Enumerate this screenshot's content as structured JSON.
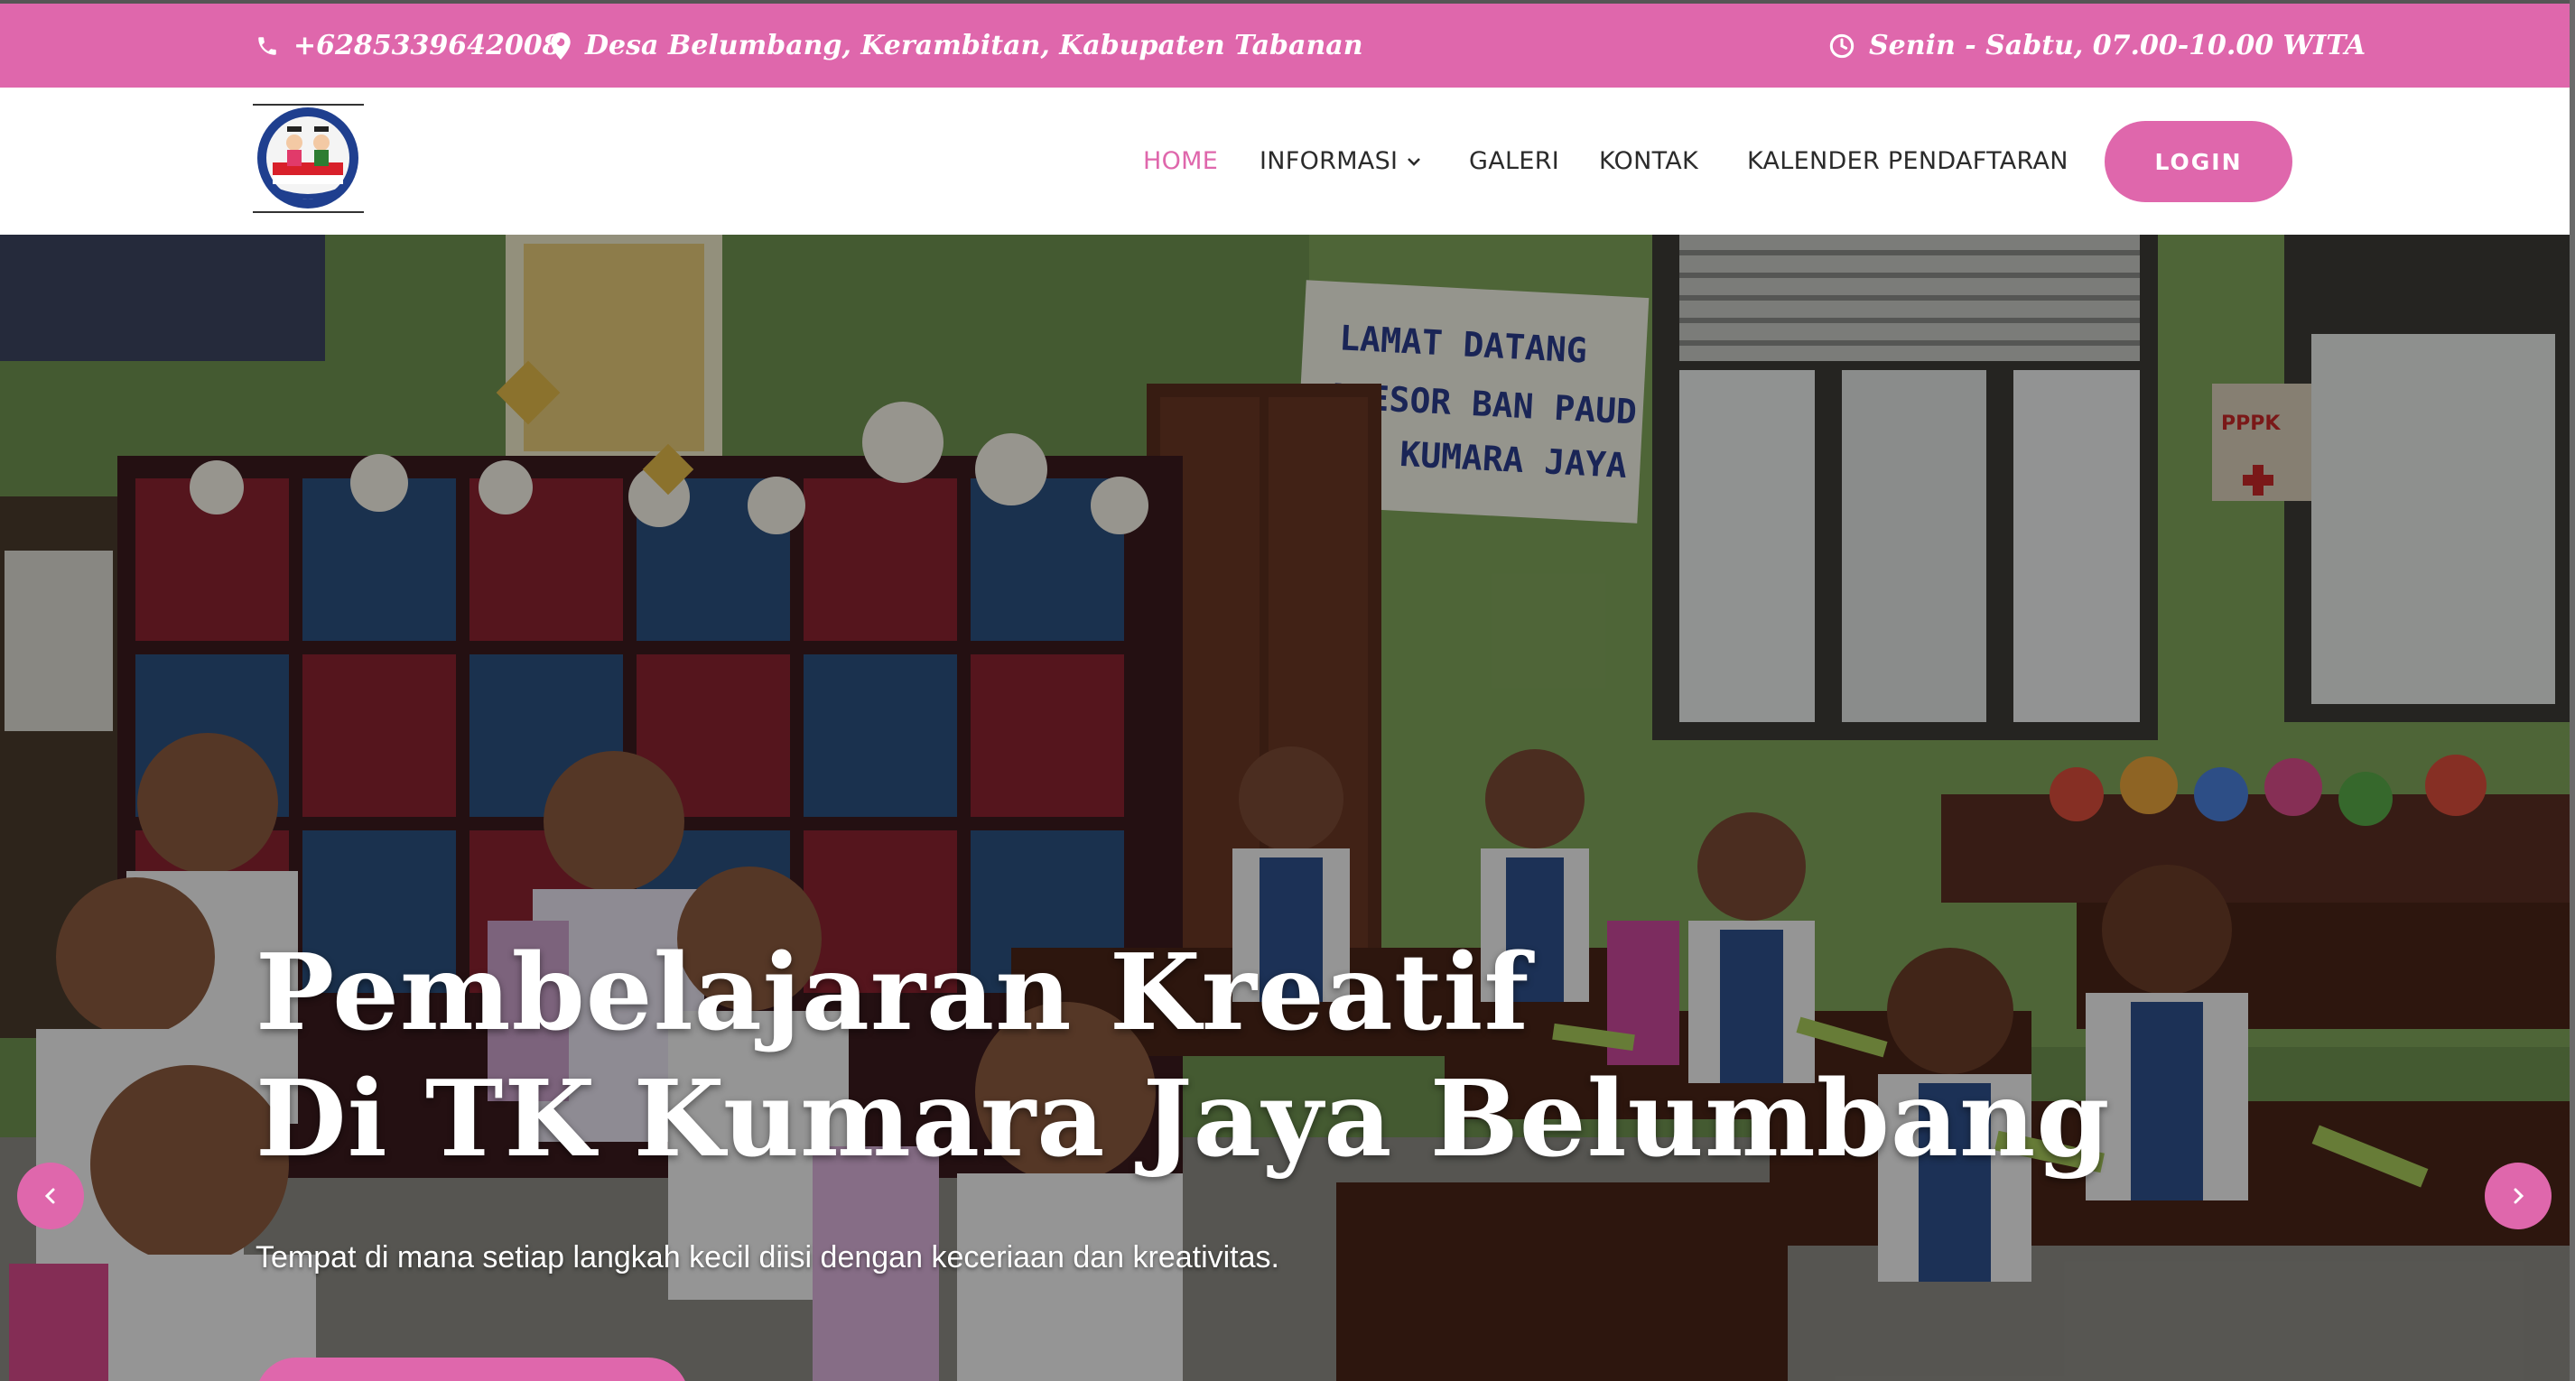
{
  "topbar": {
    "phone": "+6285339642008",
    "address": "Desa Belumbang, Kerambitan, Kabupaten Tabanan",
    "hours": "Senin - Sabtu, 07.00-10.00 WITA"
  },
  "nav": {
    "logo_alt": "TK Kumara Jaya Belumbang",
    "items": [
      {
        "label": "HOME",
        "active": true
      },
      {
        "label": "INFORMASI",
        "dropdown": true
      },
      {
        "label": "GALERI"
      },
      {
        "label": "KONTAK"
      },
      {
        "label": "KALENDER PENDAFTARAN"
      }
    ],
    "login_label": "LOGIN"
  },
  "hero": {
    "title_line1": "Pembelajaran Kreatif",
    "title_line2": "Di TK Kumara Jaya Belumbang",
    "subtitle": "Tempat di mana setiap langkah kecil diisi dengan keceriaan dan kreativitas.",
    "banner_line1": "LAMAT DATANG",
    "banner_line2": "ASESOR BAN PAUD",
    "banner_line3": "K. KUMARA JAYA",
    "box_label": "PPPK"
  },
  "colors": {
    "accent": "#df67ac",
    "nav_text": "#2b2b2b",
    "wall": "#7fa35a"
  },
  "icons": [
    "phone-icon",
    "map-marker-icon",
    "clock-icon",
    "chevron-down-icon",
    "chevron-left-icon",
    "chevron-right-icon"
  ]
}
